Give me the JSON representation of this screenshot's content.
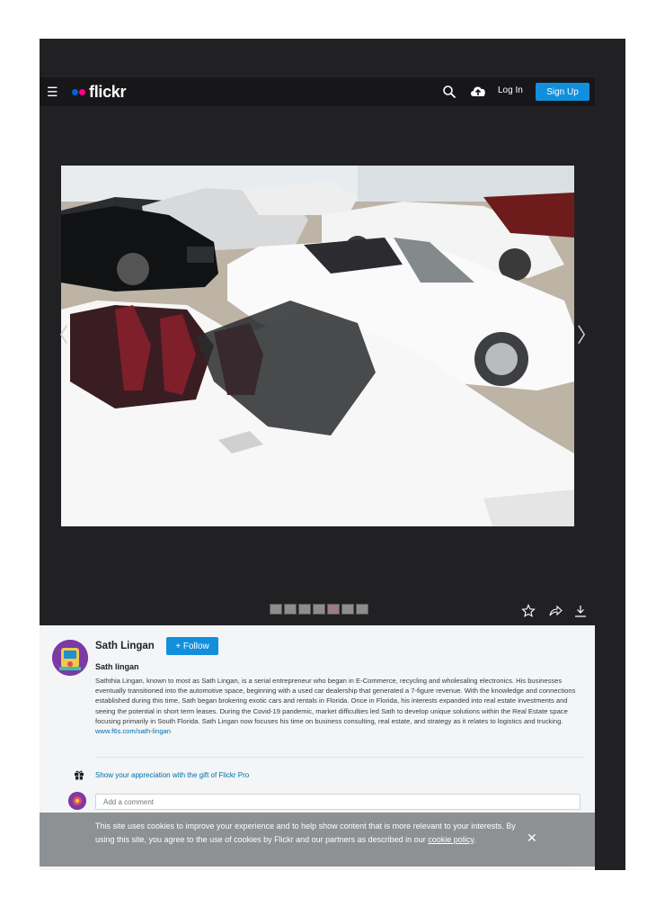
{
  "nav": {
    "brand": "flickr",
    "login_label": "Log In",
    "signup_label": "Sign Up"
  },
  "photo": {
    "alt": "White convertible cars in a showroom"
  },
  "owner": {
    "name": "Sath Lingan",
    "follow_label": "+ Follow"
  },
  "photo_info": {
    "title": "Sath lingan",
    "description": "Saththia Lingan, known to most as Sath Lingan, is a serial entrepreneur who began in E-Commerce, recycling and wholesaling electronics. His businesses eventually transitioned into the automotive space, beginning with a used car dealership that generated a 7-figure revenue. With the knowledge and connections established during this time, Sath began brokering exotic cars and rentals in Florida. Once in Florida, his interests expanded into real estate investments and seeing the potential in short term leases. During the Covid-19 pandemic, market difficulties led Sath to develop unique solutions within the Real Estate space focusing primarily in South Florida. Sath Lingan now focuses his time on business consulting, real estate, and strategy as it relates to logistics and trucking.",
    "link": "www.f6s.com/sath-lingan"
  },
  "gift": {
    "label": "Show your appreciation with the gift of Flickr Pro"
  },
  "comment": {
    "placeholder": "Add a comment"
  },
  "cookie": {
    "text": "This site uses cookies to improve your experience and to help show content that is more relevant to your interests. By using this site, you agree to the use of cookies by Flickr and our partners as described in our",
    "link_label": "cookie policy",
    "suffix": "."
  },
  "colors": {
    "frame_bg": "#212124",
    "accent_blue": "#128fdc",
    "brand_blue": "#0063dc",
    "brand_pink": "#ff0084"
  }
}
